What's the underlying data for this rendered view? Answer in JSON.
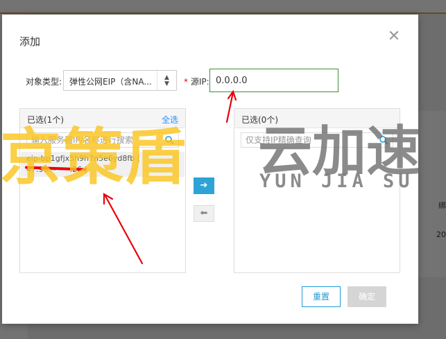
{
  "background": {
    "right_col_header": "绑",
    "right_col_value": "20"
  },
  "dialog": {
    "title": "添加",
    "close_glyph": "✕",
    "object_type_label": "对象类型:",
    "object_type_value": "弹性公网EIP（含NA...",
    "required_mark": "*",
    "source_ip_label": "源IP:",
    "source_ip_value": "0.0.0.0",
    "left_panel": {
      "header": "已选(1个)",
      "select_all": "全选",
      "search_placeholder": "输入服务器IP/名称进行搜索",
      "items": [
        {
          "line1": "eip-bp1gfjx5h9h7n5e6yd8fb (",
          "line2": "47.96.~~~.26 )"
        }
      ]
    },
    "right_panel": {
      "header": "已选(0个)",
      "search_placeholder": "仅支持IP精确查询"
    },
    "move_right_glyph": "➔",
    "move_left_glyph": "⬅",
    "reset_label": "重置",
    "ok_label": "确定"
  },
  "watermark": {
    "brand": "京策盾",
    "brand2": "云加速",
    "sub": "YUN JIA SU"
  },
  "colors": {
    "accent": "#1e9bd7",
    "input_focus": "#3c8c3c",
    "annotation_red": "#e8000b",
    "watermark_yellow": "#fac41e"
  }
}
